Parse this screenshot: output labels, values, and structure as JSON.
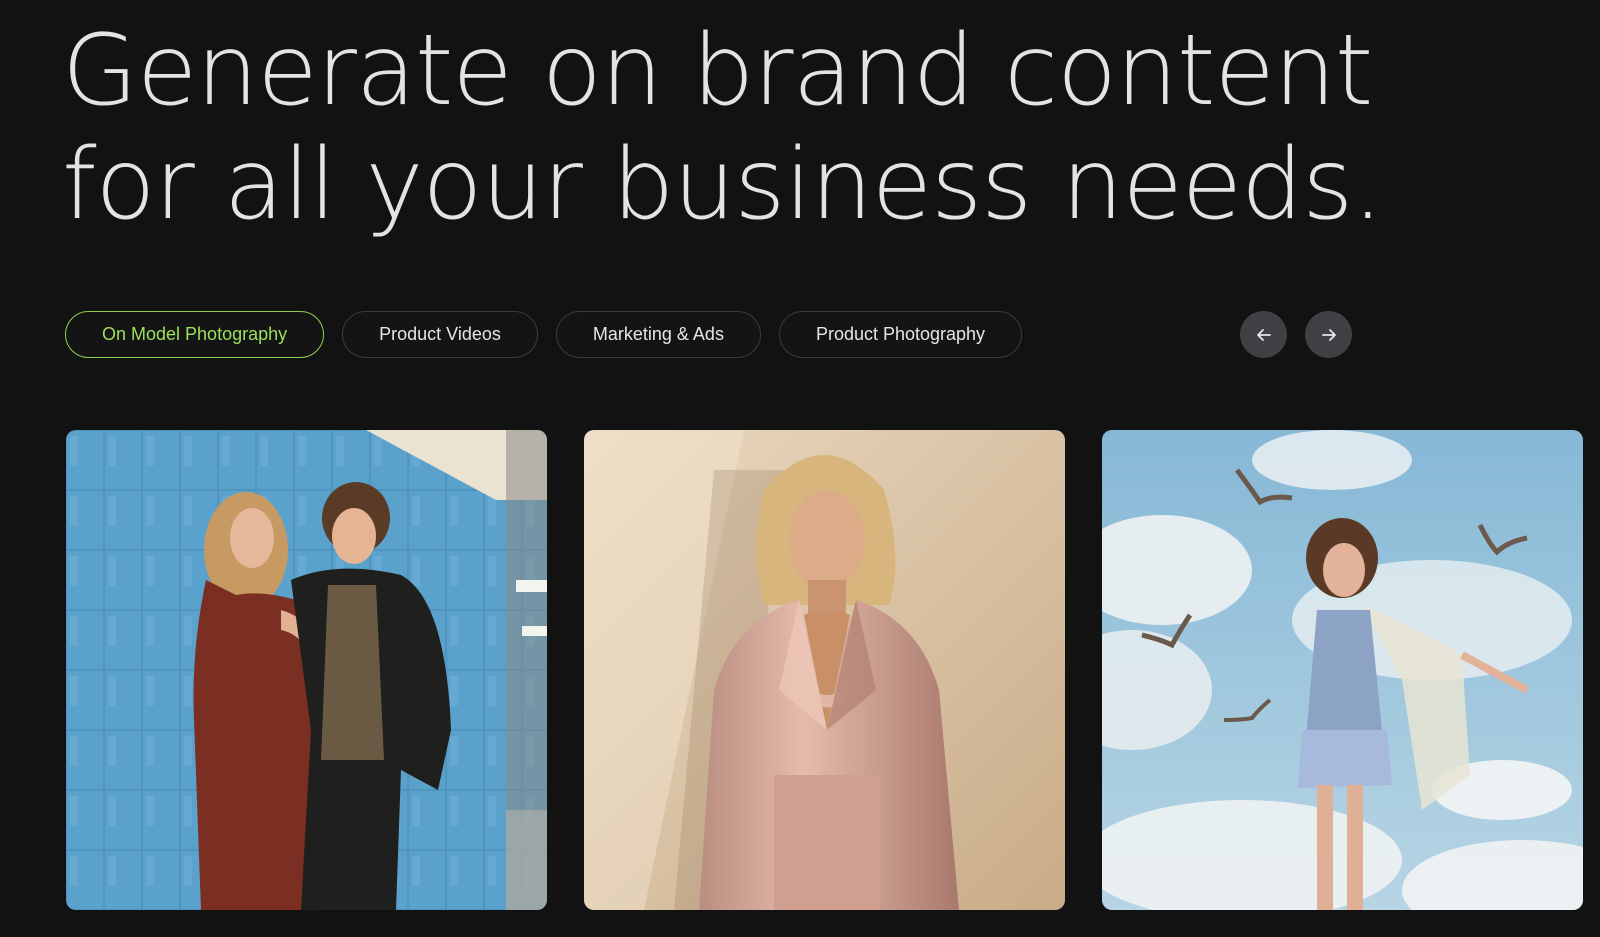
{
  "hero": {
    "headline_line1": "Generate on brand content",
    "headline_line2": "for all your business needs."
  },
  "tabs": [
    {
      "label": "On Model Photography",
      "active": true
    },
    {
      "label": "Product Videos",
      "active": false
    },
    {
      "label": "Marketing & Ads",
      "active": false
    },
    {
      "label": "Product Photography",
      "active": false
    }
  ],
  "carousel": {
    "prev_icon": "arrow-left-icon",
    "next_icon": "arrow-right-icon"
  },
  "gallery": [
    {
      "subject": "couple-by-blue-tiled-wall"
    },
    {
      "subject": "woman-in-pink-satin-suit"
    },
    {
      "subject": "woman-in-floral-dress-with-sky-and-birds"
    }
  ],
  "colors": {
    "background": "#121213",
    "accent_green": "#9be05a",
    "tab_border": "#3b3b3f",
    "nav_button": "#3f3f44"
  }
}
